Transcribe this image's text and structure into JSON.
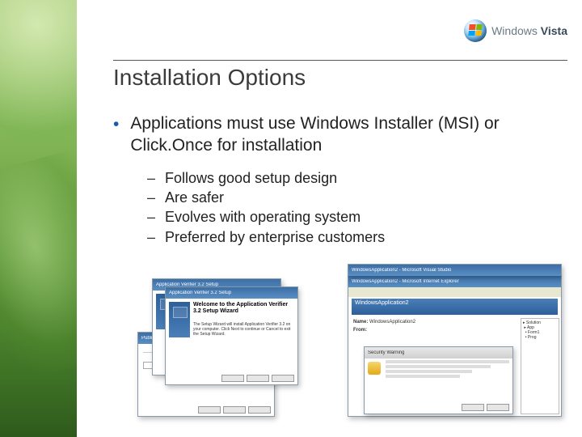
{
  "brand": {
    "name_thin": "Windows",
    "name_bold": "Vista"
  },
  "title": "Installation Options",
  "bullet": "Applications must use Windows Installer (MSI) or Click.Once for installation",
  "sub": [
    "Follows good setup design",
    "Are safer",
    "Evolves with operating system",
    "Preferred by enterprise customers"
  ],
  "thumbs": {
    "wizard_title": "Application Verifier 3.2 Setup",
    "wizard_heading": "Welcome to the Application Verifier 3.2 Setup Wizard",
    "wizard_body": "The Setup Wizard will install Application Verifier 3.2 on your computer. Click Next to continue or Cancel to exit the Setup Wizard.",
    "ie_title": "WindowsApplication2 - Microsoft Internet Explorer",
    "clickonce_banner": "WindowsApplication2",
    "clickonce_name_label": "Name:",
    "clickonce_name": "WindowsApplication2",
    "clickonce_from_label": "From:",
    "publish_title": "Publish Wizard",
    "security_title": "Security Warning",
    "vs_title": "WindowsApplication2 - Microsoft Visual Studio"
  }
}
